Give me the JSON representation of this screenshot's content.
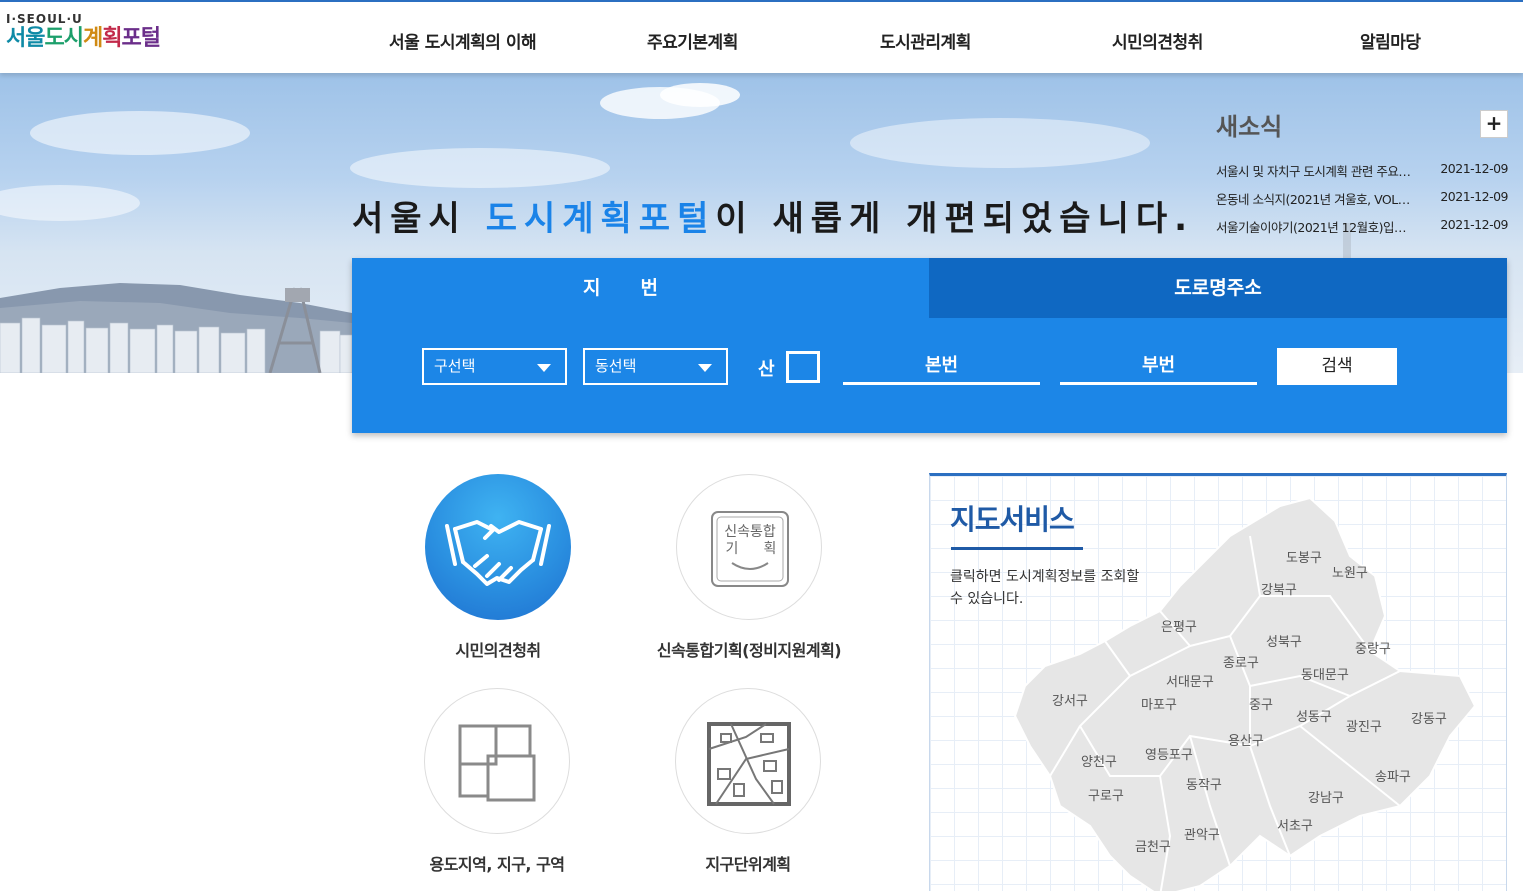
{
  "header": {
    "logo_top": "I·SEOUL·U",
    "logo_chars": [
      "서울",
      "도시",
      "계",
      "획",
      "포털"
    ],
    "nav": [
      "서울 도시계획의 이해",
      "주요기본계획",
      "도시관리계획",
      "시민의견청취",
      "알림마당"
    ]
  },
  "hero": {
    "title_prefix": "서울시 ",
    "title_highlight": "도시계획포털",
    "title_suffix": "이 새롭게 개편되었습니다."
  },
  "news": {
    "title": "새소식",
    "more": "+",
    "items": [
      {
        "text": "서울시 및 자치구 도시계획 관련 주요…",
        "date": "2021-12-09"
      },
      {
        "text": "온동네 소식지(2021년 겨울호, VOL…",
        "date": "2021-12-09"
      },
      {
        "text": "서울기술이야기(2021년 12월호)입…",
        "date": "2021-12-09"
      }
    ]
  },
  "search": {
    "tab_jibeon": "지번",
    "tab_road": "도로명주소",
    "select_gu": "구선택",
    "select_dong": "동선택",
    "san_label": "산",
    "bonbeon_placeholder": "본번",
    "bubeon_placeholder": "부번",
    "button": "검색"
  },
  "services": [
    {
      "label": "시민의견청취",
      "icon": "handshake-icon"
    },
    {
      "label": "신속통합기획(정비지원계획)",
      "icon": "rapid-planning-icon"
    },
    {
      "label": "용도지역, 지구, 구역",
      "icon": "zoning-icon"
    },
    {
      "label": "지구단위계획",
      "icon": "district-plan-icon"
    }
  ],
  "rapid_icon_text": {
    "line1": "신속통합",
    "line2": "기",
    "line3": "획"
  },
  "map": {
    "title": "지도서비스",
    "desc": "클릭하면 도시계획정보를 조회할 수 있습니다.",
    "districts": [
      "도봉구",
      "노원구",
      "강북구",
      "은평구",
      "성북구",
      "중랑구",
      "종로구",
      "서대문구",
      "동대문구",
      "강서구",
      "마포구",
      "중구",
      "성동구",
      "광진구",
      "강동구",
      "용산구",
      "양천구",
      "영등포구",
      "구로구",
      "동작구",
      "송파구",
      "강남구",
      "서초구",
      "관악구",
      "금천구"
    ]
  },
  "colors": {
    "accent": "#1c86e7",
    "tab_dark": "#0f68c2",
    "map_title": "#1f5aa6"
  }
}
